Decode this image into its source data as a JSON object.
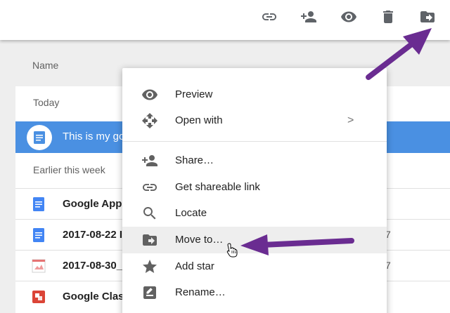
{
  "toolbar": {
    "icons": [
      "link-icon",
      "add-person-icon",
      "eye-icon",
      "trash-icon",
      "move-to-folder-icon"
    ]
  },
  "list_header": {
    "name_label": "Name"
  },
  "sections": {
    "today": "Today",
    "earlier": "Earlier this week"
  },
  "files": [
    {
      "name": "This is my go",
      "type": "doc",
      "selected": true,
      "date": ""
    },
    {
      "name": "Google Apps",
      "type": "doc",
      "selected": false,
      "date": ""
    },
    {
      "name": "2017-08-22 I",
      "type": "doc",
      "selected": false,
      "date": "7"
    },
    {
      "name": "2017-08-30_",
      "type": "image",
      "selected": false,
      "date": "7"
    },
    {
      "name": "Google Class",
      "type": "slides",
      "selected": false,
      "date": ""
    }
  ],
  "context_menu": {
    "items": [
      {
        "label": "Preview",
        "icon": "eye-icon"
      },
      {
        "label": "Open with",
        "icon": "move-arrows-icon",
        "chevron": ">"
      },
      {
        "label": "Share…",
        "icon": "add-person-icon"
      },
      {
        "label": "Get shareable link",
        "icon": "link-icon"
      },
      {
        "label": "Locate",
        "icon": "search-icon"
      },
      {
        "label": "Move to…",
        "icon": "move-to-folder-icon",
        "highlighted": true
      },
      {
        "label": "Add star",
        "icon": "star-icon"
      },
      {
        "label": "Rename…",
        "icon": "rename-icon"
      }
    ]
  },
  "colors": {
    "selected_row": "#4a90e2",
    "annotation_arrow": "#6a2c91",
    "doc_blue": "#4285f4",
    "slides_red": "#db4437"
  }
}
